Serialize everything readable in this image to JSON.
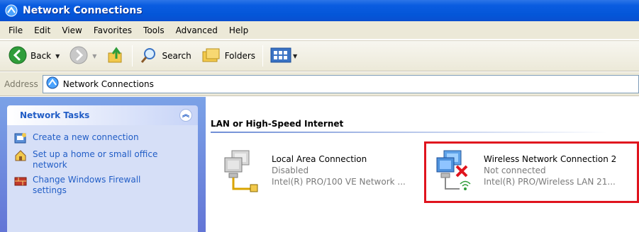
{
  "window": {
    "title": "Network Connections"
  },
  "menubar": {
    "items": [
      "File",
      "Edit",
      "View",
      "Favorites",
      "Tools",
      "Advanced",
      "Help"
    ]
  },
  "toolbar": {
    "back_label": "Back",
    "search_label": "Search",
    "folders_label": "Folders"
  },
  "address": {
    "label": "Address",
    "value": "Network Connections"
  },
  "task_panel": {
    "title": "Network Tasks",
    "tasks": [
      "Create a new connection",
      "Set up a home or small office network",
      "Change Windows Firewall settings"
    ]
  },
  "group": {
    "title": "LAN or High-Speed Internet"
  },
  "connections": [
    {
      "name": "Local Area Connection",
      "status": "Disabled",
      "device": "Intel(R) PRO/100 VE Network ..."
    },
    {
      "name": "Wireless Network Connection 2",
      "status": "Not connected",
      "device": "Intel(R) PRO/Wireless LAN 21..."
    }
  ],
  "colors": {
    "titlebar": "#0456d8",
    "task_link": "#215dc6",
    "highlight": "#e0141e"
  }
}
